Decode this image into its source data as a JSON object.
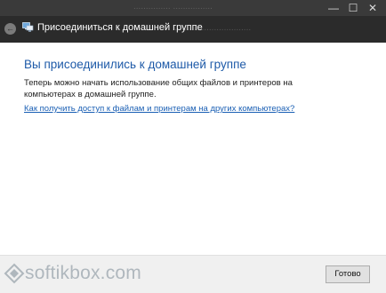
{
  "titlebar": {
    "title": "Присоединиться к домашней группе",
    "background_ghost_text": "...............  ................",
    "background_ghost_text2": "...............................",
    "minimize": "—",
    "maximize": "☐",
    "close": "✕",
    "back": "←"
  },
  "main": {
    "heading": "Вы присоединились к домашней группе",
    "body": "Теперь можно начать использование общих файлов и принтеров на компьютерах в домашней группе.",
    "link": "Как получить доступ к файлам и принтерам на других компьютерах?"
  },
  "footer": {
    "done_label": "Готово"
  },
  "watermark": {
    "text": "softikbox.com"
  },
  "colors": {
    "titlebar": "#2b2b2b",
    "heading": "#1e5aa8",
    "link": "#1a5fb4"
  }
}
